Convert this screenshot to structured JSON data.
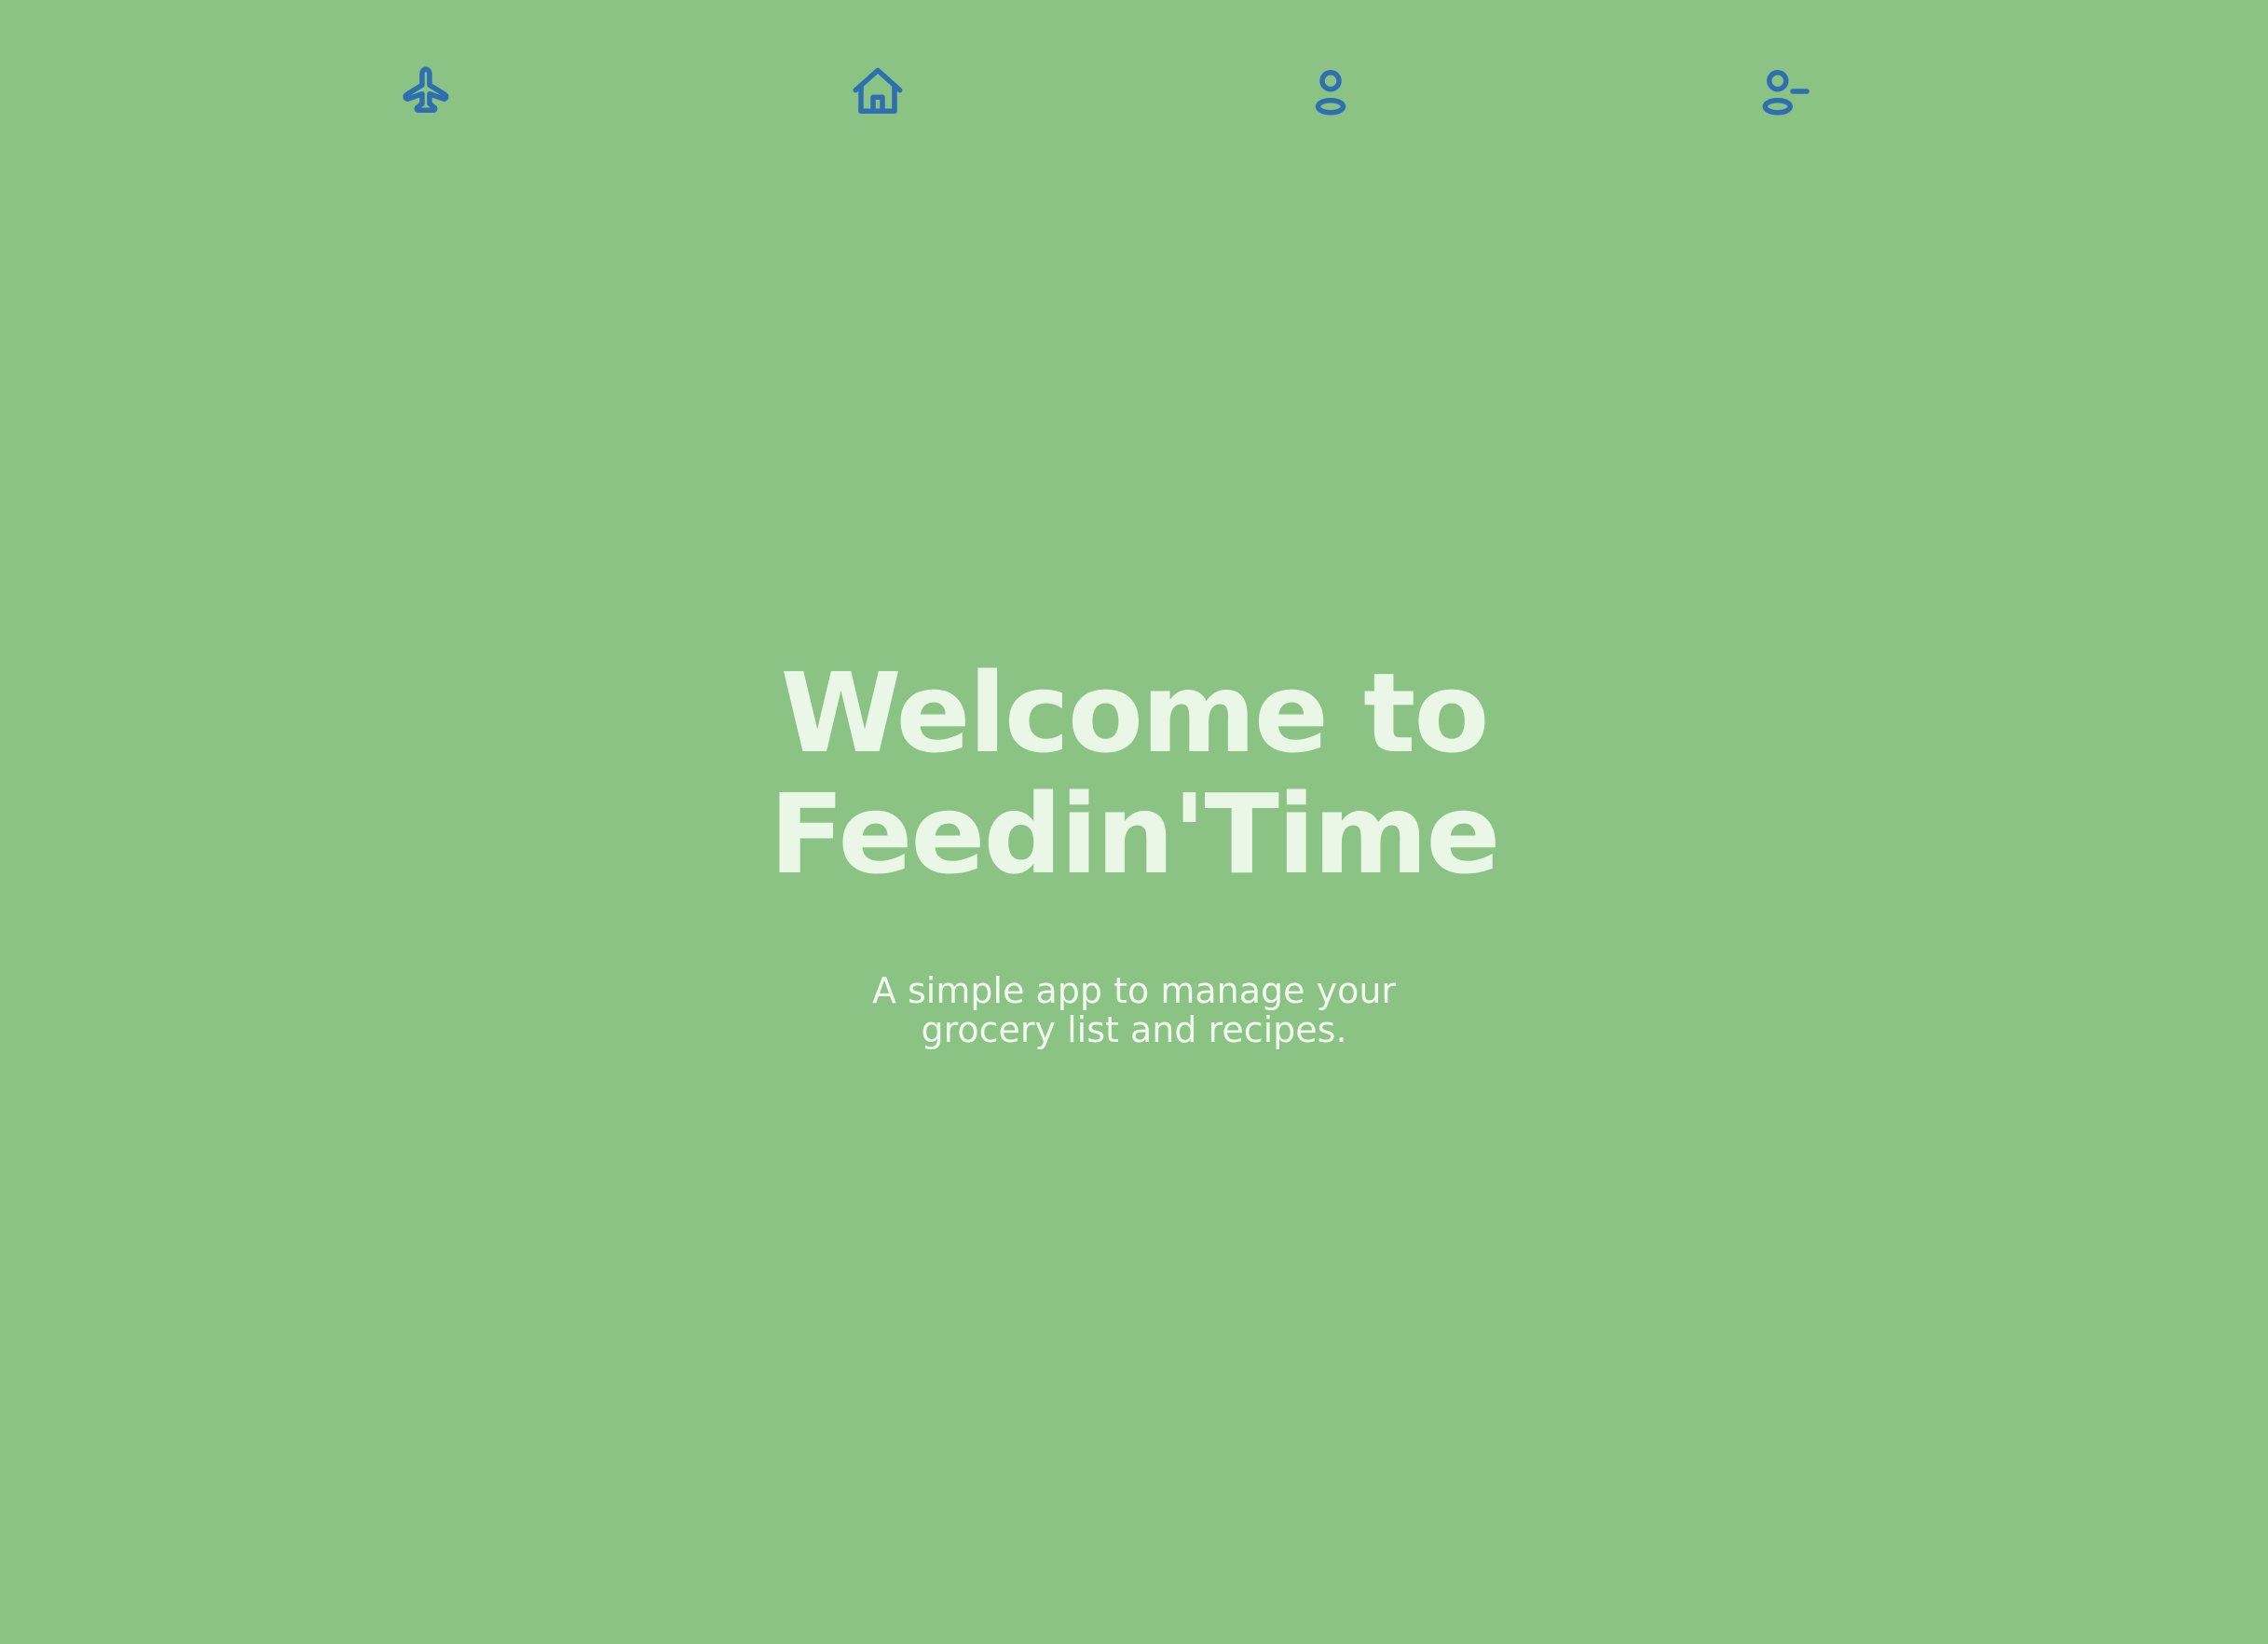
{
  "colors": {
    "background": "#8bc385",
    "icon": "#2f6faf",
    "title": "#ebf7e6",
    "subtitle": "#f2faef"
  },
  "nav": {
    "items": [
      {
        "icon": "airplane-icon"
      },
      {
        "icon": "home-icon"
      },
      {
        "icon": "user-icon"
      },
      {
        "icon": "user-minus-icon"
      }
    ]
  },
  "hero": {
    "title_line1": "Welcome to",
    "title_line2": "Feedin'Time",
    "subtitle_line1": "A simple app to manage your",
    "subtitle_line2": "grocery list and recipes."
  }
}
